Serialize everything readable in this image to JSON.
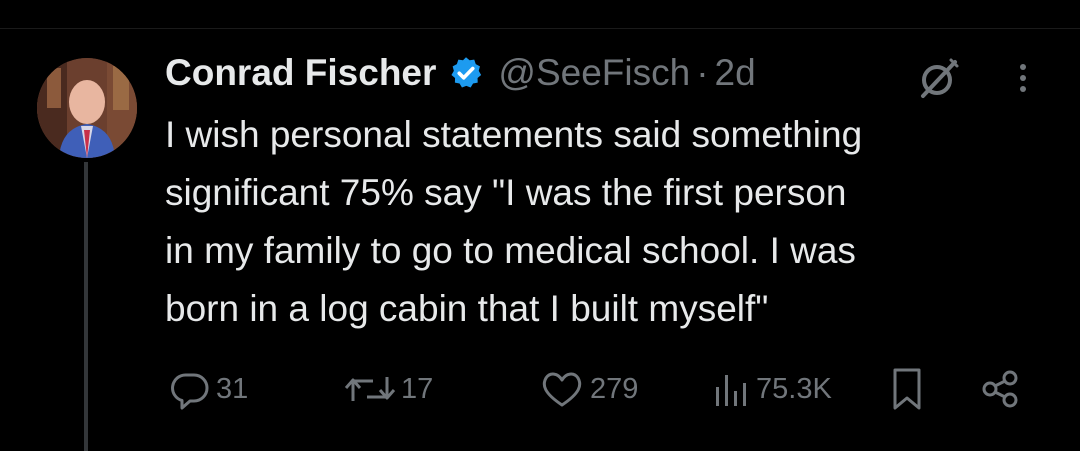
{
  "tweet": {
    "author_name": "Conrad Fischer",
    "handle": "@SeeFisch",
    "separator": "·",
    "time": "2d",
    "text": "I wish personal statements said something\nsignificant 75% say \"I was the first person\nin my family to go to medical school. I was\nborn in a log cabin that I built myself\"",
    "verified": true,
    "verified_color": "#1d9bf0"
  },
  "actions": {
    "reply_count": "31",
    "retweet_count": "17",
    "like_count": "279",
    "views_count": "75.3K"
  },
  "icons": {
    "reply": "reply-icon",
    "retweet": "retweet-icon",
    "like": "heart-icon",
    "views": "views-icon",
    "bookmark": "bookmark-icon",
    "share": "share-icon",
    "grok": "grok-icon",
    "more": "more-icon",
    "verified": "verified-badge-icon"
  },
  "colors": {
    "background": "#000000",
    "primary_text": "#e7e9ea",
    "secondary_text": "#71767b"
  }
}
